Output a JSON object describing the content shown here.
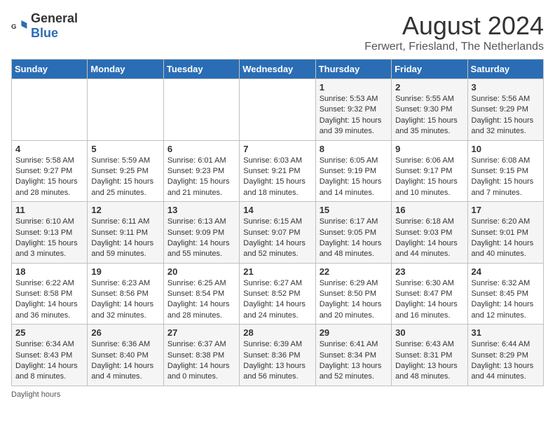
{
  "header": {
    "logo_general": "General",
    "logo_blue": "Blue",
    "month_title": "August 2024",
    "location": "Ferwert, Friesland, The Netherlands"
  },
  "days_of_week": [
    "Sunday",
    "Monday",
    "Tuesday",
    "Wednesday",
    "Thursday",
    "Friday",
    "Saturday"
  ],
  "weeks": [
    [
      {
        "day": "",
        "info": ""
      },
      {
        "day": "",
        "info": ""
      },
      {
        "day": "",
        "info": ""
      },
      {
        "day": "",
        "info": ""
      },
      {
        "day": "1",
        "info": "Sunrise: 5:53 AM\nSunset: 9:32 PM\nDaylight: 15 hours and 39 minutes."
      },
      {
        "day": "2",
        "info": "Sunrise: 5:55 AM\nSunset: 9:30 PM\nDaylight: 15 hours and 35 minutes."
      },
      {
        "day": "3",
        "info": "Sunrise: 5:56 AM\nSunset: 9:29 PM\nDaylight: 15 hours and 32 minutes."
      }
    ],
    [
      {
        "day": "4",
        "info": "Sunrise: 5:58 AM\nSunset: 9:27 PM\nDaylight: 15 hours and 28 minutes."
      },
      {
        "day": "5",
        "info": "Sunrise: 5:59 AM\nSunset: 9:25 PM\nDaylight: 15 hours and 25 minutes."
      },
      {
        "day": "6",
        "info": "Sunrise: 6:01 AM\nSunset: 9:23 PM\nDaylight: 15 hours and 21 minutes."
      },
      {
        "day": "7",
        "info": "Sunrise: 6:03 AM\nSunset: 9:21 PM\nDaylight: 15 hours and 18 minutes."
      },
      {
        "day": "8",
        "info": "Sunrise: 6:05 AM\nSunset: 9:19 PM\nDaylight: 15 hours and 14 minutes."
      },
      {
        "day": "9",
        "info": "Sunrise: 6:06 AM\nSunset: 9:17 PM\nDaylight: 15 hours and 10 minutes."
      },
      {
        "day": "10",
        "info": "Sunrise: 6:08 AM\nSunset: 9:15 PM\nDaylight: 15 hours and 7 minutes."
      }
    ],
    [
      {
        "day": "11",
        "info": "Sunrise: 6:10 AM\nSunset: 9:13 PM\nDaylight: 15 hours and 3 minutes."
      },
      {
        "day": "12",
        "info": "Sunrise: 6:11 AM\nSunset: 9:11 PM\nDaylight: 14 hours and 59 minutes."
      },
      {
        "day": "13",
        "info": "Sunrise: 6:13 AM\nSunset: 9:09 PM\nDaylight: 14 hours and 55 minutes."
      },
      {
        "day": "14",
        "info": "Sunrise: 6:15 AM\nSunset: 9:07 PM\nDaylight: 14 hours and 52 minutes."
      },
      {
        "day": "15",
        "info": "Sunrise: 6:17 AM\nSunset: 9:05 PM\nDaylight: 14 hours and 48 minutes."
      },
      {
        "day": "16",
        "info": "Sunrise: 6:18 AM\nSunset: 9:03 PM\nDaylight: 14 hours and 44 minutes."
      },
      {
        "day": "17",
        "info": "Sunrise: 6:20 AM\nSunset: 9:01 PM\nDaylight: 14 hours and 40 minutes."
      }
    ],
    [
      {
        "day": "18",
        "info": "Sunrise: 6:22 AM\nSunset: 8:58 PM\nDaylight: 14 hours and 36 minutes."
      },
      {
        "day": "19",
        "info": "Sunrise: 6:23 AM\nSunset: 8:56 PM\nDaylight: 14 hours and 32 minutes."
      },
      {
        "day": "20",
        "info": "Sunrise: 6:25 AM\nSunset: 8:54 PM\nDaylight: 14 hours and 28 minutes."
      },
      {
        "day": "21",
        "info": "Sunrise: 6:27 AM\nSunset: 8:52 PM\nDaylight: 14 hours and 24 minutes."
      },
      {
        "day": "22",
        "info": "Sunrise: 6:29 AM\nSunset: 8:50 PM\nDaylight: 14 hours and 20 minutes."
      },
      {
        "day": "23",
        "info": "Sunrise: 6:30 AM\nSunset: 8:47 PM\nDaylight: 14 hours and 16 minutes."
      },
      {
        "day": "24",
        "info": "Sunrise: 6:32 AM\nSunset: 8:45 PM\nDaylight: 14 hours and 12 minutes."
      }
    ],
    [
      {
        "day": "25",
        "info": "Sunrise: 6:34 AM\nSunset: 8:43 PM\nDaylight: 14 hours and 8 minutes."
      },
      {
        "day": "26",
        "info": "Sunrise: 6:36 AM\nSunset: 8:40 PM\nDaylight: 14 hours and 4 minutes."
      },
      {
        "day": "27",
        "info": "Sunrise: 6:37 AM\nSunset: 8:38 PM\nDaylight: 14 hours and 0 minutes."
      },
      {
        "day": "28",
        "info": "Sunrise: 6:39 AM\nSunset: 8:36 PM\nDaylight: 13 hours and 56 minutes."
      },
      {
        "day": "29",
        "info": "Sunrise: 6:41 AM\nSunset: 8:34 PM\nDaylight: 13 hours and 52 minutes."
      },
      {
        "day": "30",
        "info": "Sunrise: 6:43 AM\nSunset: 8:31 PM\nDaylight: 13 hours and 48 minutes."
      },
      {
        "day": "31",
        "info": "Sunrise: 6:44 AM\nSunset: 8:29 PM\nDaylight: 13 hours and 44 minutes."
      }
    ]
  ],
  "footer": {
    "daylight_label": "Daylight hours"
  }
}
